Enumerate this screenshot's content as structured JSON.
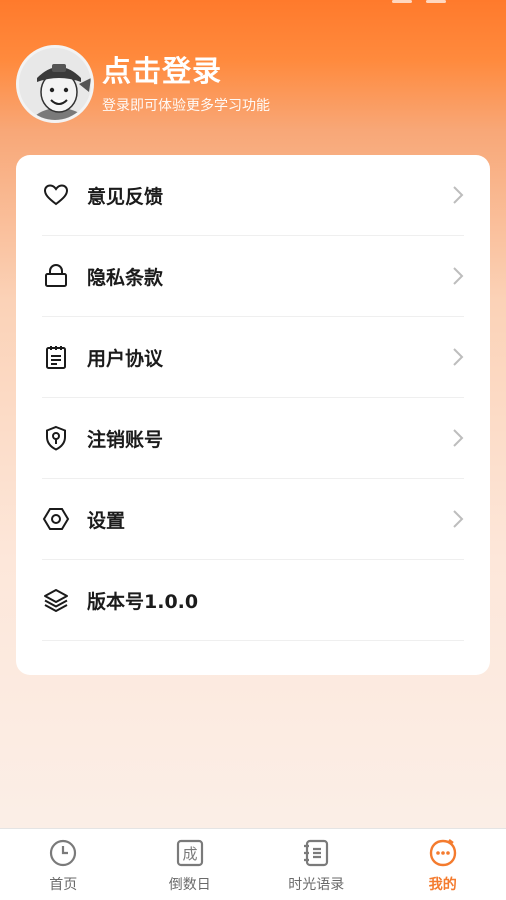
{
  "profile": {
    "title": "点击登录",
    "subtitle": "登录即可体验更多学习功能"
  },
  "menu": [
    {
      "label": "意见反馈",
      "icon": "heart-icon",
      "has_arrow": true
    },
    {
      "label": "隐私条款",
      "icon": "lock-icon",
      "has_arrow": true
    },
    {
      "label": "用户协议",
      "icon": "document-icon",
      "has_arrow": true
    },
    {
      "label": "注销账号",
      "icon": "shield-key-icon",
      "has_arrow": true
    },
    {
      "label": "设置",
      "icon": "hexagon-settings-icon",
      "has_arrow": true
    },
    {
      "label": "版本号1.0.0",
      "icon": "layers-icon",
      "has_arrow": false
    }
  ],
  "tabs": [
    {
      "label": "首页",
      "icon": "clock-icon",
      "active": false
    },
    {
      "label": "倒数日",
      "icon": "idiom-icon",
      "icon_char": "成",
      "active": false
    },
    {
      "label": "时光语录",
      "icon": "notebook-icon",
      "active": false
    },
    {
      "label": "我的",
      "icon": "face-icon",
      "active": true
    }
  ],
  "colors": {
    "accent": "#f47b2e",
    "header_gradient_top": "#ff7a2c",
    "text_primary": "#1b1b1b",
    "chevron": "#bdbdbd"
  }
}
